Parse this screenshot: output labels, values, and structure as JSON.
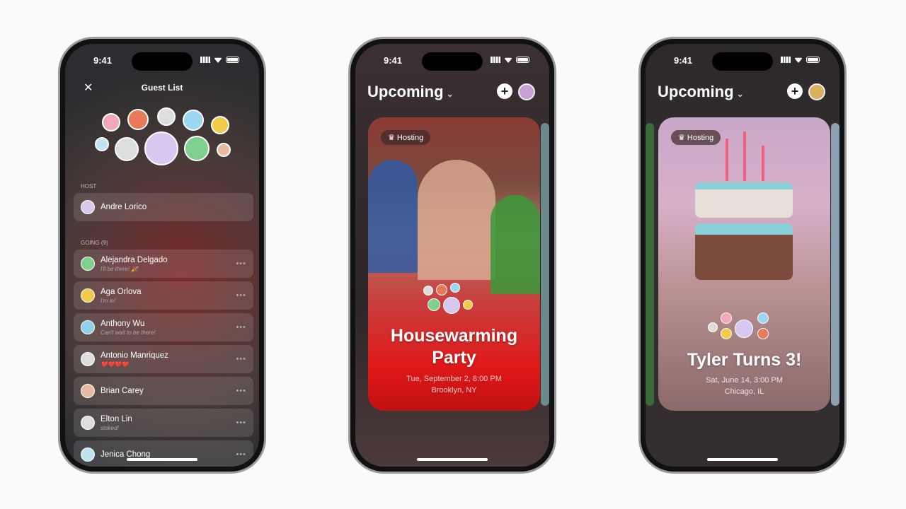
{
  "status": {
    "time": "9:41"
  },
  "guest_list": {
    "title": "Guest List",
    "close_icon": "close-icon",
    "host_label": "HOST",
    "host": {
      "name": "Andre Lorico"
    },
    "going_label": "GOING (9)",
    "guests": [
      {
        "name": "Alejandra Delgado",
        "note": "I'll be there! 🎉",
        "color": "#7fcf8e"
      },
      {
        "name": "Aga Orlova",
        "note": "I'm in!",
        "color": "#f3cb4a"
      },
      {
        "name": "Anthony Wu",
        "note": "Can't wait to be there!",
        "color": "#8fd0e6"
      },
      {
        "name": "Antonio Manriquez",
        "note": "❤️❤️❤️❤️",
        "color": "#ddd"
      },
      {
        "name": "Brian Carey",
        "note": "",
        "color": "#e9b9a0"
      },
      {
        "name": "Elton Lin",
        "note": "stoked!",
        "color": "#ddd"
      },
      {
        "name": "Jenica Chong",
        "note": "",
        "color": "#bfe3ef"
      }
    ],
    "more_icon": "ellipsis-icon"
  },
  "upcoming": {
    "title": "Upcoming",
    "chevron": "chevron-down-icon",
    "add_icon": "plus-icon"
  },
  "events": [
    {
      "badge": "Hosting",
      "badge_icon": "crown-icon",
      "title_line1": "Housewarming",
      "title_line2": "Party",
      "date": "Tue, September 2, 8:00 PM",
      "location": "Brooklyn, NY",
      "accent": "#e01010"
    },
    {
      "badge": "Hosting",
      "badge_icon": "crown-icon",
      "title_line1": "Tyler Turns 3!",
      "title_line2": "",
      "date": "Sat, June 14, 3:00 PM",
      "location": "Chicago, IL",
      "accent": "#8a7070"
    }
  ]
}
